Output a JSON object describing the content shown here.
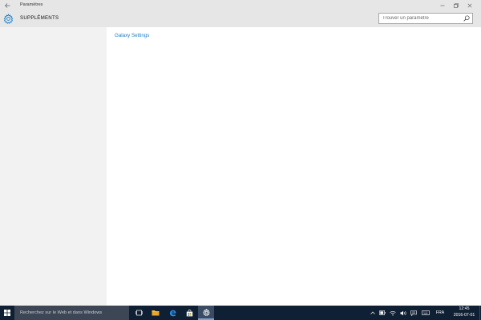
{
  "window": {
    "title": "Paramètres",
    "controls": [
      "minimize-icon",
      "restore-icon",
      "close-icon"
    ]
  },
  "header": {
    "title": "SUPPLÉMENTS",
    "icon": "gear-icon"
  },
  "search": {
    "placeholder": "Trouver un paramètre",
    "value": "",
    "icon": "search-icon"
  },
  "content": {
    "links": [
      {
        "label": "Galaxy Settings"
      }
    ]
  },
  "taskbar": {
    "search_placeholder": "Recherchez sur le Web et dans Windows",
    "pinned": [
      "task-view-icon",
      "file-explorer-icon",
      "edge-icon",
      "store-icon",
      "settings-icon"
    ],
    "tray": {
      "icons": [
        "chevron-up-icon",
        "battery-icon",
        "wifi-icon",
        "volume-icon",
        "notification-icon",
        "keyboard-icon"
      ],
      "language": "FRA",
      "time": "12:45",
      "date": "2016-07-01"
    }
  },
  "colors": {
    "accent": "#1c7bc4",
    "titlebar": "#e6e6e6",
    "nav_background": "#f2f2f2",
    "taskbar": "#102034",
    "taskbar_search": "#3c4655"
  }
}
